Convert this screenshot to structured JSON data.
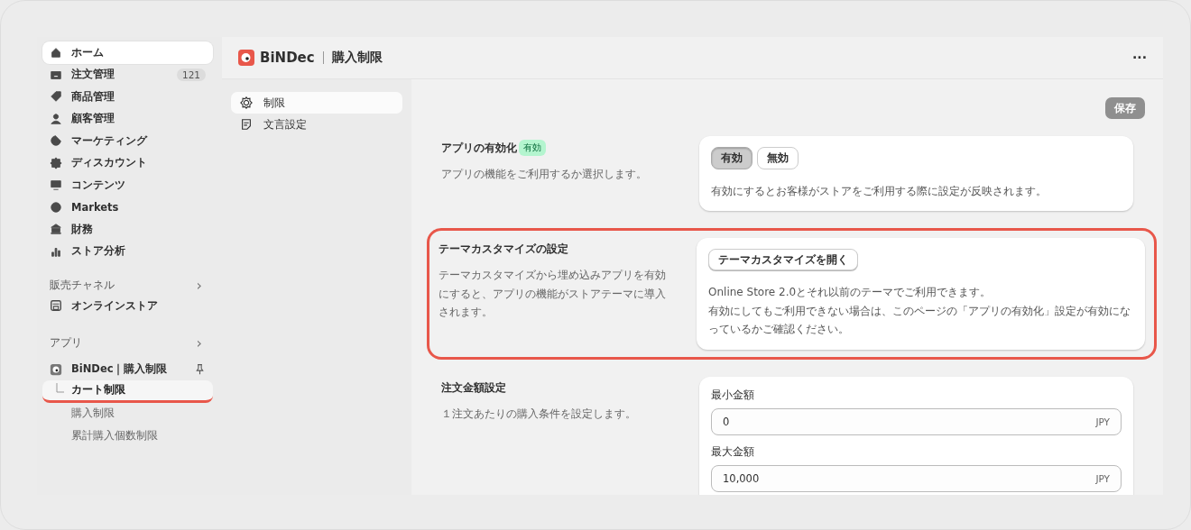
{
  "sidebar": {
    "items": [
      {
        "label": "ホーム",
        "selected": true
      },
      {
        "label": "注文管理",
        "selected": false,
        "badge": "121"
      },
      {
        "label": "商品管理",
        "selected": false
      },
      {
        "label": "顧客管理",
        "selected": false
      },
      {
        "label": "マーケティング",
        "selected": false
      },
      {
        "label": "ディスカウント",
        "selected": false
      },
      {
        "label": "コンテンツ",
        "selected": false
      },
      {
        "label": "Markets",
        "selected": false
      },
      {
        "label": "財務",
        "selected": false
      },
      {
        "label": "ストア分析",
        "selected": false
      }
    ],
    "sales_channels": {
      "heading": "販売チャネル",
      "chevron": "›",
      "items": [
        {
          "label": "オンラインストア",
          "selected": false
        }
      ]
    },
    "apps": {
      "heading": "アプリ",
      "chevron": "›",
      "app": {
        "label": "BiNDec｜購入制限"
      },
      "children": [
        {
          "label": "カート制限",
          "selected": true,
          "highlighted": true
        },
        {
          "label": "購入制限",
          "selected": false,
          "highlighted": false
        },
        {
          "label": "累計購入個数制限",
          "selected": false,
          "highlighted": false
        }
      ]
    }
  },
  "header": {
    "brand": "BiNDec",
    "title": "購入制限",
    "more": "···"
  },
  "subnav": [
    {
      "label": "制限",
      "selected": true
    },
    {
      "label": "文言設定",
      "selected": false
    }
  ],
  "save_button": {
    "label": "保存",
    "disabled": true
  },
  "sections": [
    {
      "kind": "toggle",
      "title": "アプリの有効化",
      "badge": "有効",
      "description": "アプリの機能をご利用するか選択します。",
      "highlighted": false,
      "options": [
        {
          "label": "有効",
          "selected": true
        },
        {
          "label": "無効",
          "selected": false
        }
      ],
      "note": "有効にするとお客様がストアをご利用する際に設定が反映されます。"
    },
    {
      "kind": "action",
      "title": "テーマカスタマイズの設定",
      "description": "テーマカスタマイズから埋め込みアプリを有効にすると、アプリの機能がストアテーマに導入されます。",
      "highlighted": true,
      "button": "テーマカスタマイズを開く",
      "lines": [
        "Online Store 2.0とそれ以前のテーマでご利用できます。",
        "有効にしてもご利用できない場合は、このページの「アプリの有効化」設定が有効になっているかご確認ください。"
      ]
    },
    {
      "kind": "fields",
      "title": "注文金額設定",
      "description": "１注文あたりの購入条件を設定します。",
      "highlighted": false,
      "fields": [
        {
          "label": "最小金額",
          "value": "0",
          "suffix": "JPY"
        },
        {
          "label": "最大金額",
          "value": "10,000",
          "suffix": "JPY"
        }
      ]
    }
  ]
}
